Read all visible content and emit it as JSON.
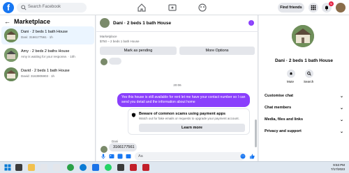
{
  "topbar": {
    "search_placeholder": "Search Facebook",
    "find_friends": "Find friends",
    "notification_count": "5"
  },
  "left": {
    "title": "Marketplace",
    "conversations": [
      {
        "name": "Dani · 2 beds 1 bath House",
        "sub": "Dani: 3166177561 · 1h"
      },
      {
        "name": "Amy · 2 beds 2 baths House",
        "sub": "Amy is waiting for your response. · 10h"
      },
      {
        "name": "David · 2 beds 1 bath House",
        "sub": "David: 3163905903 · 1h"
      }
    ]
  },
  "chat": {
    "title": "Dani · 2 beds 1 bath House",
    "marketplace_label": "Marketplace",
    "listing": "$750 – 2 beds 1 bath House",
    "mark_pending": "Mark as pending",
    "more_options": "More Options",
    "timestamp": "20:06",
    "my_message": "Yes this house is still available for rent let me have your contact number so I can send you detail and the information about home",
    "warning_title": "Beware of common scams using payment apps",
    "warning_body": "Watch out for fake emails or requests to upgrade your payment account.",
    "learn_more": "Learn more",
    "sender_label": "Dani",
    "last_message": "3166177561",
    "composer_placeholder": "Aa"
  },
  "right": {
    "name": "Dani · 2 beds 1 bath House",
    "mute": "Mute",
    "search": "Search",
    "sections": [
      "Customise chat",
      "Chat members",
      "Media, files and links",
      "Privacy and support"
    ]
  },
  "taskbar": {
    "time": "9:53 PM",
    "date": "7/17/2023"
  },
  "colors": {
    "brand": "#1877f2",
    "accent": "#8a3ffc",
    "notification": "#e41e3f"
  }
}
